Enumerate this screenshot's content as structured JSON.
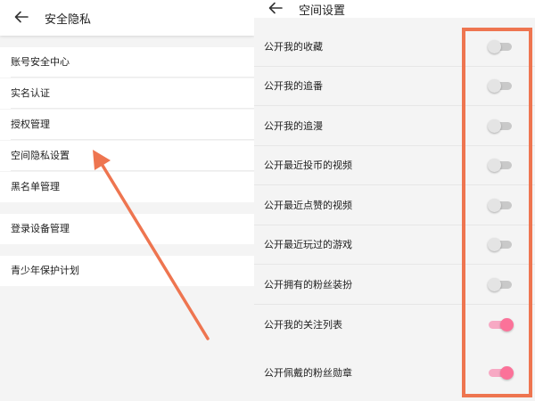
{
  "left_screen": {
    "title": "安全隐私",
    "back_icon": "arrow-left-icon",
    "groups": [
      [
        "账号安全中心",
        "实名认证",
        "授权管理",
        "空间隐私设置",
        "黑名单管理"
      ],
      [
        "登录设备管理"
      ],
      [
        "青少年保护计划"
      ]
    ]
  },
  "right_screen": {
    "title": "空间设置",
    "back_icon": "arrow-left-icon",
    "settings": [
      {
        "label": "公开我的收藏",
        "enabled": false
      },
      {
        "label": "公开我的追番",
        "enabled": false
      },
      {
        "label": "公开我的追漫",
        "enabled": false
      },
      {
        "label": "公开最近投币的视频",
        "enabled": false
      },
      {
        "label": "公开最近点赞的视频",
        "enabled": false
      },
      {
        "label": "公开最近玩过的游戏",
        "enabled": false
      },
      {
        "label": "公开拥有的粉丝装扮",
        "enabled": false
      },
      {
        "label": "公开我的关注列表",
        "enabled": true
      },
      {
        "label": "公开佩戴的粉丝勋章",
        "enabled": true
      }
    ]
  },
  "annotation": {
    "color": "#ee7550",
    "arrow_target": "空间隐私设置",
    "highlight_target": "toggle-column"
  },
  "colors": {
    "toggle_on_thumb": "#fb7299",
    "toggle_on_track": "#f7a9c4",
    "toggle_off_thumb": "#e4e4e4",
    "toggle_off_track": "#c9c9c9",
    "background": "#f4f4f4"
  }
}
